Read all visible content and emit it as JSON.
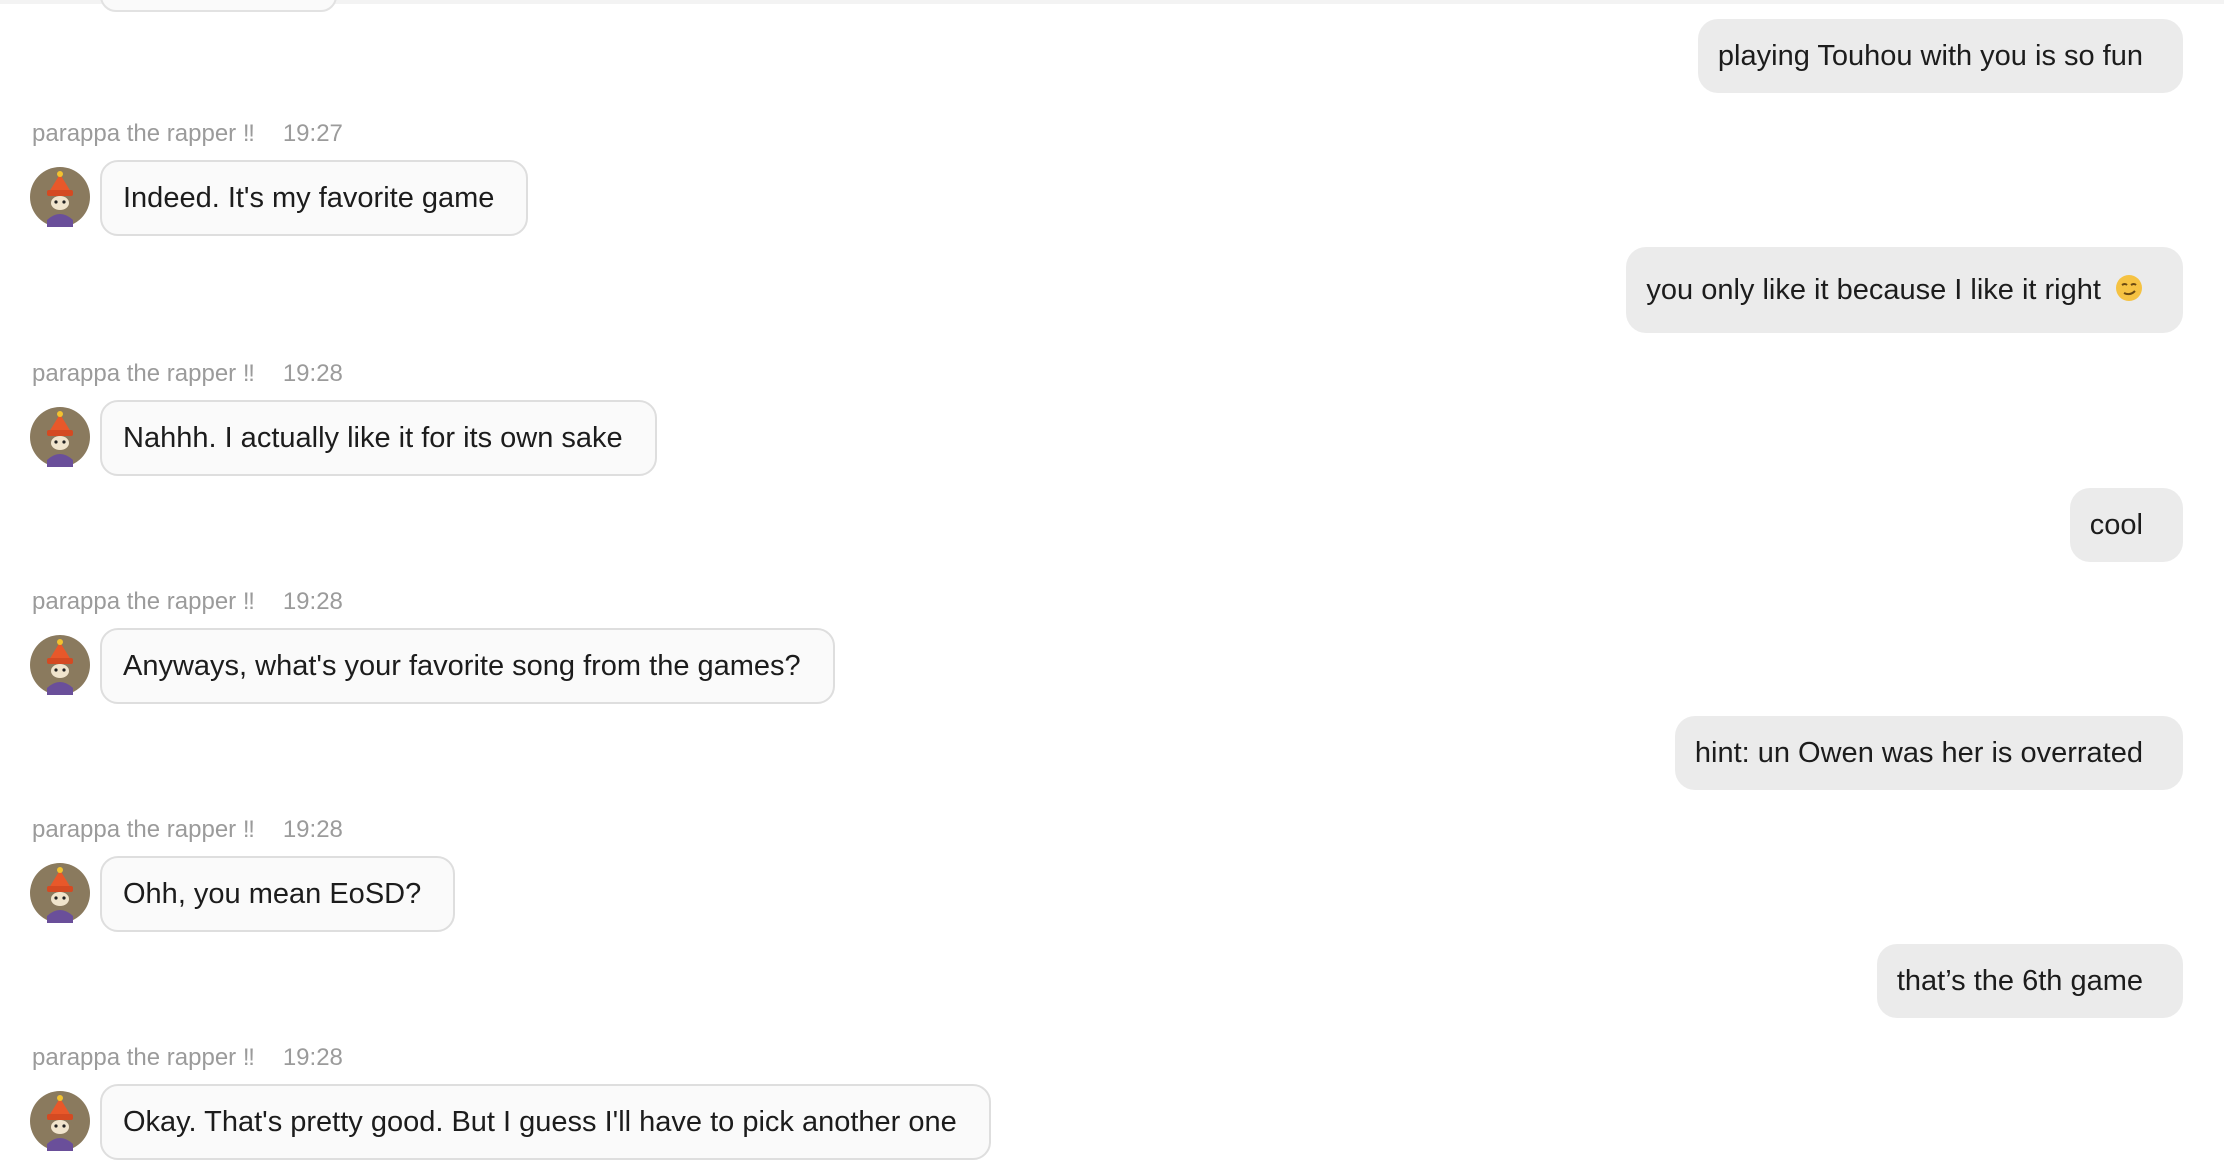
{
  "chat": {
    "messages": [
      {
        "direction": "outgoing",
        "text": "playing Touhou with you is so fun"
      },
      {
        "direction": "incoming",
        "sender": "parappa the rapper ‼",
        "time": "19:27",
        "text": "Indeed. It's my favorite game"
      },
      {
        "direction": "outgoing",
        "text": "you only like it because I like it right",
        "emoji": "smirking-face"
      },
      {
        "direction": "incoming",
        "sender": "parappa the rapper ‼",
        "time": "19:28",
        "text": "Nahhh. I actually like it for its own sake"
      },
      {
        "direction": "outgoing",
        "text": "cool"
      },
      {
        "direction": "incoming",
        "sender": "parappa the rapper ‼",
        "time": "19:28",
        "text": "Anyways, what's your favorite song from the games?"
      },
      {
        "direction": "outgoing",
        "text": "hint: un Owen was her is overrated"
      },
      {
        "direction": "incoming",
        "sender": "parappa the rapper ‼",
        "time": "19:28",
        "text": "Ohh, you mean EoSD?"
      },
      {
        "direction": "outgoing",
        "text": "that’s the 6th game"
      },
      {
        "direction": "incoming",
        "sender": "parappa the rapper ‼",
        "time": "19:28",
        "text": "Okay. That's pretty good. But I guess I'll have to pick another one"
      }
    ]
  },
  "colors": {
    "incoming_bubble_bg": "#fafafa",
    "incoming_bubble_border": "#dedede",
    "outgoing_bubble_bg": "#ebebeb",
    "meta_text": "#9b9b9b",
    "message_text": "#1c1c1c"
  }
}
